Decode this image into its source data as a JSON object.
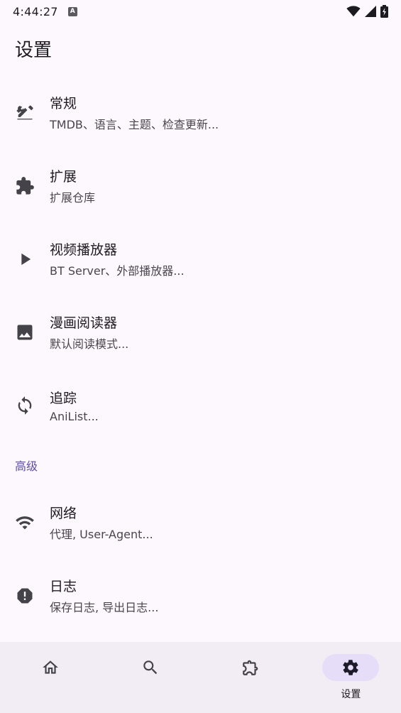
{
  "status_bar": {
    "time": "4:44:27",
    "notification_icon": "keyboard-notification-icon",
    "wifi_icon": "wifi-icon",
    "signal_icon": "cell-signal-icon",
    "battery_icon": "battery-charging-icon"
  },
  "header": {
    "title": "设置"
  },
  "settings": {
    "items": [
      {
        "icon": "tools-icon",
        "title": "常规",
        "subtitle": "TMDB、语言、主题、检查更新..."
      },
      {
        "icon": "puzzle-icon",
        "title": "扩展",
        "subtitle": "扩展仓库"
      },
      {
        "icon": "play-icon",
        "title": "视频播放器",
        "subtitle": "BT Server、外部播放器..."
      },
      {
        "icon": "image-icon",
        "title": "漫画阅读器",
        "subtitle": "默认阅读模式..."
      },
      {
        "icon": "sync-icon",
        "title": "追踪",
        "subtitle": "AniList..."
      }
    ],
    "advanced_header": "高级",
    "advanced_items": [
      {
        "icon": "wifi-icon",
        "title": "网络",
        "subtitle": "代理, User-Agent..."
      },
      {
        "icon": "alert-octagon-icon",
        "title": "日志",
        "subtitle": "保存日志, 导出日志..."
      }
    ]
  },
  "bottom_nav": {
    "items": [
      {
        "icon": "home-icon",
        "label": ""
      },
      {
        "icon": "search-icon",
        "label": ""
      },
      {
        "icon": "puzzle-outline-icon",
        "label": ""
      },
      {
        "icon": "gear-icon",
        "label": "设置",
        "active": true
      }
    ]
  },
  "colors": {
    "background": "#fdf8fd",
    "accent": "#5b4fa0",
    "nav_background": "#f2edf4",
    "active_pill": "#e6def8"
  }
}
